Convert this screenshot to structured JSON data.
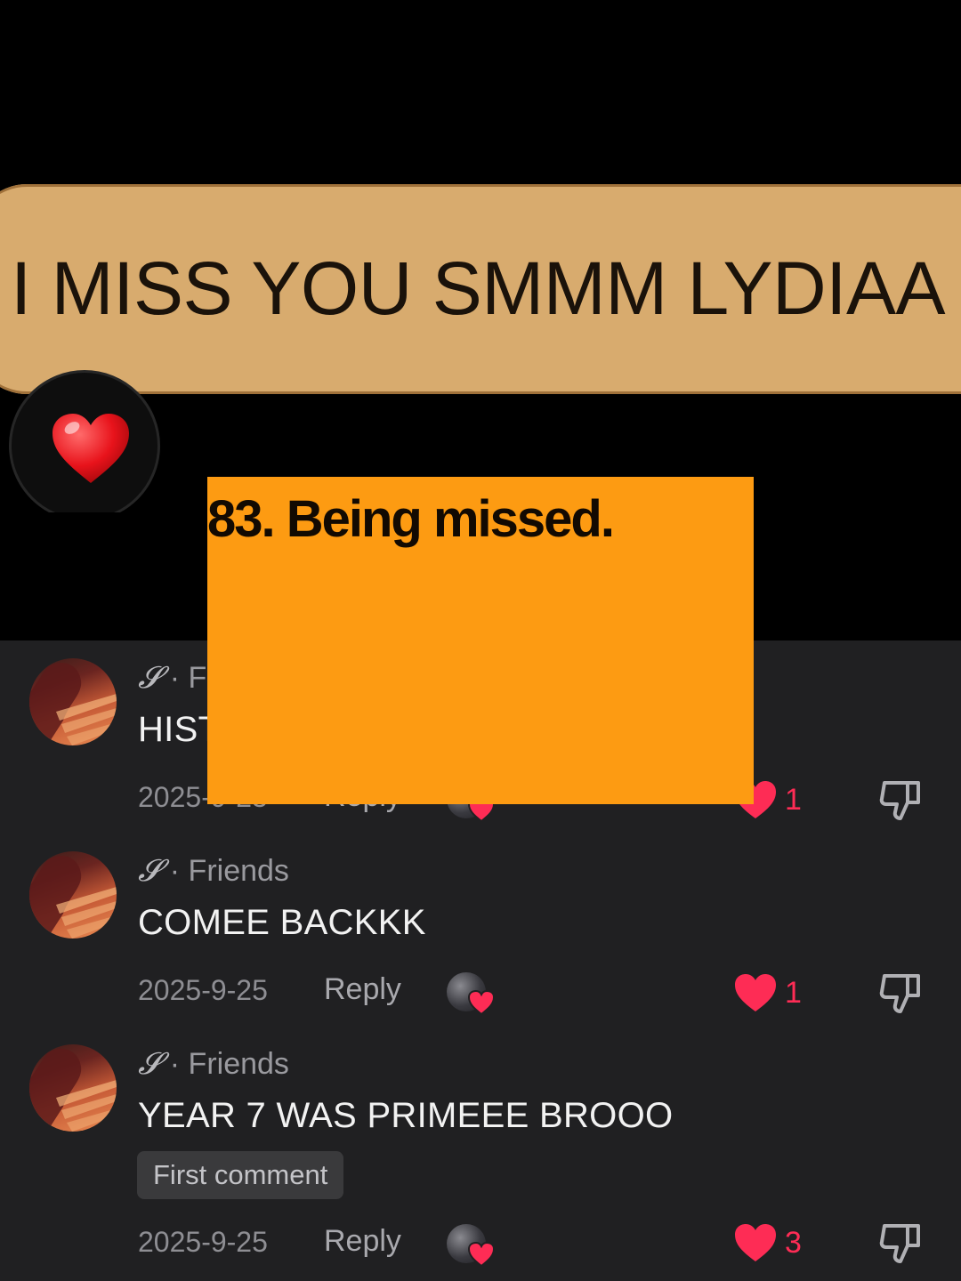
{
  "hero": {
    "message": "I MISS YOU SMMM LYDIAA",
    "reaction": "heart-emoji"
  },
  "overlay": {
    "caption": "83. Being missed."
  },
  "colors": {
    "bubble": "#d8ab6e",
    "overlay": "#fd9b12",
    "like": "#fe2c55",
    "comments_bg": "#202022"
  },
  "comments": [
    {
      "initial": "𝓢",
      "label": "· Friends",
      "text": "HISTORY",
      "date": "2025-9-25",
      "reply": "Reply",
      "likes": "1"
    },
    {
      "initial": "𝓢",
      "label": "· Friends",
      "text": "COMEE BACKKK",
      "date": "2025-9-25",
      "reply": "Reply",
      "likes": "1"
    },
    {
      "initial": "𝓢",
      "label": "· Friends",
      "text": "YEAR 7 WAS PRIMEEE BROOO",
      "badge": "First comment",
      "date": "2025-9-25",
      "reply": "Reply",
      "likes": "3"
    }
  ]
}
